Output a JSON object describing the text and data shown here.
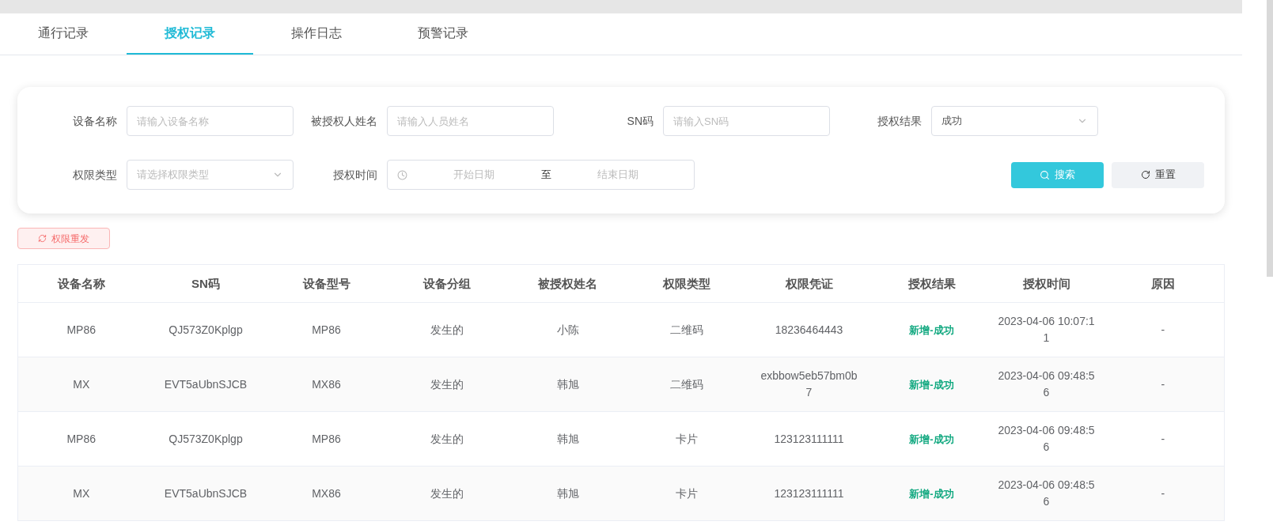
{
  "tabs": [
    {
      "label": "通行记录",
      "selected": false
    },
    {
      "label": "授权记录",
      "selected": true
    },
    {
      "label": "操作日志",
      "selected": false
    },
    {
      "label": "预警记录",
      "selected": false
    }
  ],
  "filters": [
    {
      "kind": "input",
      "label": "设备名称",
      "placeholder": "请输入设备名称"
    },
    {
      "kind": "input",
      "label": "被授权人姓名",
      "placeholder": "请输入人员姓名"
    },
    {
      "kind": "input",
      "label": "SN码",
      "placeholder": "请输入SN码"
    },
    {
      "kind": "select",
      "label": "授权结果",
      "value": "成功"
    },
    {
      "kind": "select",
      "label": "权限类型",
      "placeholder": "请选择权限类型"
    },
    {
      "kind": "daterange",
      "label": "授权时间",
      "start_placeholder": "开始日期",
      "separator": "至",
      "end_placeholder": "结束日期"
    }
  ],
  "search_button": "搜索",
  "reset_button": "重置",
  "resend_button": "权限重发",
  "table": {
    "columns": [
      "设备名称",
      "SN码",
      "设备型号",
      "设备分组",
      "被授权姓名",
      "权限类型",
      "权限凭证",
      "授权结果",
      "授权时间",
      "原因"
    ],
    "rows": [
      [
        "MP86",
        "QJ573Z0Kplgp",
        "MP86",
        "发生的",
        "小陈",
        "二维码",
        "18236464443",
        "新增-成功",
        "2023-04-06 10:07:11",
        "-"
      ],
      [
        "MX",
        "EVT5aUbnSJCB",
        "MX86",
        "发生的",
        "韩旭",
        "二维码",
        "exbbow5eb57bm0b7",
        "新增-成功",
        "2023-04-06 09:48:56",
        "-"
      ],
      [
        "MP86",
        "QJ573Z0Kplgp",
        "MP86",
        "发生的",
        "韩旭",
        "卡片",
        "123123111111",
        "新增-成功",
        "2023-04-06 09:48:56",
        "-"
      ],
      [
        "MX",
        "EVT5aUbnSJCB",
        "MX86",
        "发生的",
        "韩旭",
        "卡片",
        "123123111111",
        "新增-成功",
        "2023-04-06 09:48:56",
        "-"
      ]
    ]
  }
}
